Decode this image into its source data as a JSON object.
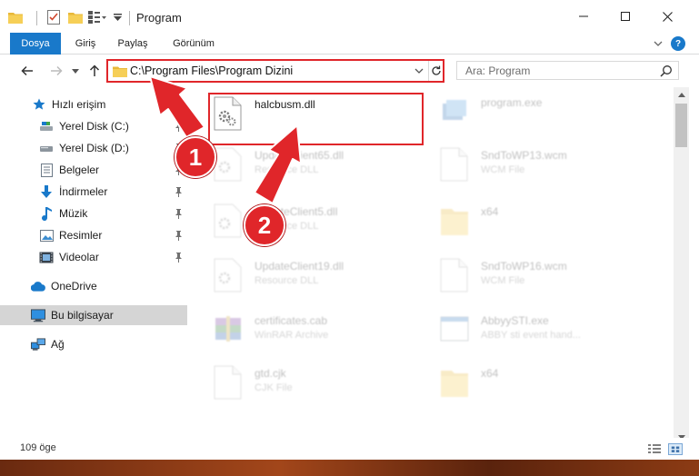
{
  "window": {
    "title": "Program",
    "controls": {
      "minimize": "minimize",
      "maximize": "maximize",
      "close": "close"
    }
  },
  "ribbon": {
    "tabs": [
      "Dosya",
      "Giriş",
      "Paylaş",
      "Görünüm"
    ],
    "help": "?"
  },
  "nav": {
    "address": "C:\\Program Files\\Program Dizini",
    "search_placeholder": "Ara: Program"
  },
  "sidebar": {
    "items": [
      {
        "label": "Hızlı erişim",
        "icon": "star-icon",
        "pinned": false
      },
      {
        "label": "Yerel Disk (C:)",
        "icon": "drive-icon",
        "pinned": true
      },
      {
        "label": "Yerel Disk (D:)",
        "icon": "drive-icon",
        "pinned": true
      },
      {
        "label": "Belgeler",
        "icon": "documents-icon",
        "pinned": true
      },
      {
        "label": "İndirmeler",
        "icon": "downloads-icon",
        "pinned": true
      },
      {
        "label": "Müzik",
        "icon": "music-icon",
        "pinned": true
      },
      {
        "label": "Resimler",
        "icon": "pictures-icon",
        "pinned": true
      },
      {
        "label": "Videolar",
        "icon": "videos-icon",
        "pinned": true
      },
      {
        "label": "OneDrive",
        "icon": "onedrive-icon",
        "pinned": false
      },
      {
        "label": "Bu bilgisayar",
        "icon": "this-pc-icon",
        "pinned": false
      },
      {
        "label": "Ağ",
        "icon": "network-icon",
        "pinned": false
      }
    ]
  },
  "files": [
    {
      "name": "halcbusm.dll",
      "type": "",
      "icon": "dll-gear-icon",
      "highlighted": true
    },
    {
      "name": "program.exe",
      "type": "",
      "icon": "exe-icon",
      "highlighted": false
    },
    {
      "name": "UpdateClient65.dll",
      "type": "Resource DLL",
      "icon": "dll-gear-icon",
      "highlighted": false
    },
    {
      "name": "SndToWP13.wcm",
      "type": "WCM File",
      "icon": "blank-file-icon",
      "highlighted": false
    },
    {
      "name": "UpdateClient5.dll",
      "type": "Resource DLL",
      "icon": "dll-gear-icon",
      "highlighted": false
    },
    {
      "name": "x64",
      "type": "",
      "icon": "folder-icon",
      "highlighted": false
    },
    {
      "name": "UpdateClient19.dll",
      "type": "Resource DLL",
      "icon": "dll-gear-icon",
      "highlighted": false
    },
    {
      "name": "SndToWP16.wcm",
      "type": "WCM File",
      "icon": "blank-file-icon",
      "highlighted": false
    },
    {
      "name": "certificates.cab",
      "type": "WinRAR Archive",
      "icon": "winrar-icon",
      "highlighted": false
    },
    {
      "name": "AbbyySTI.exe",
      "type": "ABBY sti event hand...",
      "icon": "app-window-icon",
      "highlighted": false
    },
    {
      "name": "gtd.cjk",
      "type": "CJK File",
      "icon": "blank-file-icon",
      "highlighted": false
    },
    {
      "name": "x64",
      "type": "",
      "icon": "folder-icon",
      "highlighted": false
    }
  ],
  "status": {
    "item_count": "109 öge"
  },
  "annotations": {
    "step1": "1",
    "step2": "2"
  },
  "colors": {
    "accent": "#1979ca",
    "highlight": "#e0262a",
    "selected": "#d5d5d5"
  }
}
